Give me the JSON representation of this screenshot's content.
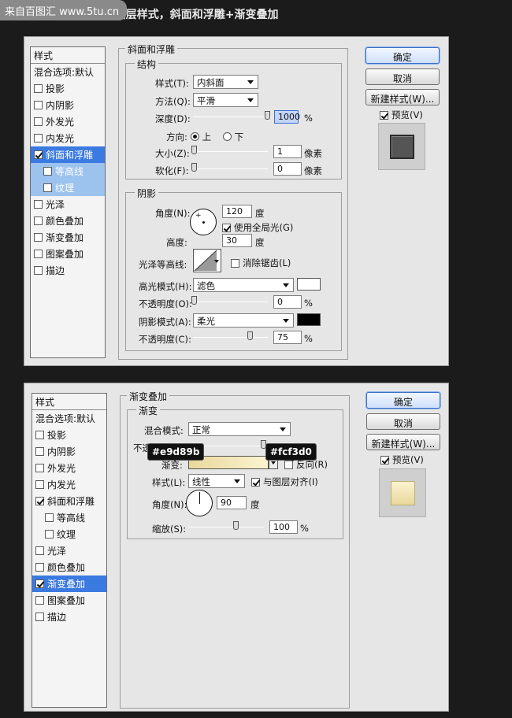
{
  "watermark": "来自百图汇 www.5tu.cn",
  "step_title": "步骤4：给字体加上图层样式，斜面和浮雕+渐变叠加",
  "colors": {
    "bevel_highlight": "#ffffff",
    "bevel_shadow": "#000000",
    "grad_start": "#e9d89b",
    "grad_end": "#fcf3d0",
    "selected_row": "#3b7ae0"
  },
  "dialog1": {
    "list_header": "样式",
    "blend_defaults": "混合选项:默认",
    "items": [
      {
        "label": "投影",
        "checked": false
      },
      {
        "label": "内阴影",
        "checked": false
      },
      {
        "label": "外发光",
        "checked": false
      },
      {
        "label": "内发光",
        "checked": false
      },
      {
        "label": "斜面和浮雕",
        "checked": true
      },
      {
        "label": "等高线",
        "checked": false
      },
      {
        "label": "纹理",
        "checked": false
      },
      {
        "label": "光泽",
        "checked": false
      },
      {
        "label": "颜色叠加",
        "checked": false
      },
      {
        "label": "渐变叠加",
        "checked": false
      },
      {
        "label": "图案叠加",
        "checked": false
      },
      {
        "label": "描边",
        "checked": false
      }
    ],
    "panel_title": "斜面和浮雕",
    "structure": {
      "title": "结构",
      "style_label": "样式(T):",
      "style_value": "内斜面",
      "technique_label": "方法(Q):",
      "technique_value": "平滑",
      "depth_label": "深度(D):",
      "depth_value": "1000",
      "depth_unit": "%",
      "direction_label": "方向:",
      "dir_up": "上",
      "dir_down": "下",
      "size_label": "大小(Z):",
      "size_value": "1",
      "size_unit": "像素",
      "soften_label": "软化(F):",
      "soften_value": "0",
      "soften_unit": "像素"
    },
    "shading": {
      "title": "阴影",
      "angle_label": "角度(N):",
      "angle_value": "120",
      "angle_unit": "度",
      "global_light": "使用全局光(G)",
      "altitude_label": "高度:",
      "altitude_value": "30",
      "altitude_unit": "度",
      "gloss_label": "光泽等高线:",
      "antialias": "消除锯齿(L)",
      "highlight_label": "高光模式(H):",
      "highlight_value": "滤色",
      "hl_opacity_label": "不透明度(O):",
      "hl_opacity_value": "0",
      "hl_opacity_unit": "%",
      "shadow_label": "阴影模式(A):",
      "shadow_value": "柔光",
      "sh_opacity_label": "不透明度(C):",
      "sh_opacity_value": "75",
      "sh_opacity_unit": "%"
    },
    "buttons": {
      "ok": "确定",
      "cancel": "取消",
      "new_style": "新建样式(W)...",
      "preview": "预览(V)"
    }
  },
  "dialog2": {
    "list_header": "样式",
    "blend_defaults": "混合选项:默认",
    "items": [
      {
        "label": "投影",
        "checked": false
      },
      {
        "label": "内阴影",
        "checked": false
      },
      {
        "label": "外发光",
        "checked": false
      },
      {
        "label": "内发光",
        "checked": false
      },
      {
        "label": "斜面和浮雕",
        "checked": true
      },
      {
        "label": "等高线",
        "checked": false
      },
      {
        "label": "纹理",
        "checked": false
      },
      {
        "label": "光泽",
        "checked": false
      },
      {
        "label": "颜色叠加",
        "checked": false
      },
      {
        "label": "渐变叠加",
        "checked": true
      },
      {
        "label": "图案叠加",
        "checked": false
      },
      {
        "label": "描边",
        "checked": false
      }
    ],
    "panel_title": "渐变叠加",
    "gradient": {
      "title": "渐变",
      "blend_label": "混合模式:",
      "blend_value": "正常",
      "opacity_label": "不透",
      "gradient_label": "渐变:",
      "reverse": "反向(R)",
      "style_label": "样式(L):",
      "style_value": "线性",
      "align_label": "与图层对齐(I)",
      "angle_label": "角度(N):",
      "angle_value": "90",
      "angle_unit": "度",
      "scale_label": "缩放(S):",
      "scale_value": "100",
      "scale_unit": "%",
      "tip_left": "#e9d89b",
      "tip_right": "#fcf3d0"
    },
    "buttons": {
      "ok": "确定",
      "cancel": "取消",
      "new_style": "新建样式(W)...",
      "preview": "预览(V)"
    }
  }
}
